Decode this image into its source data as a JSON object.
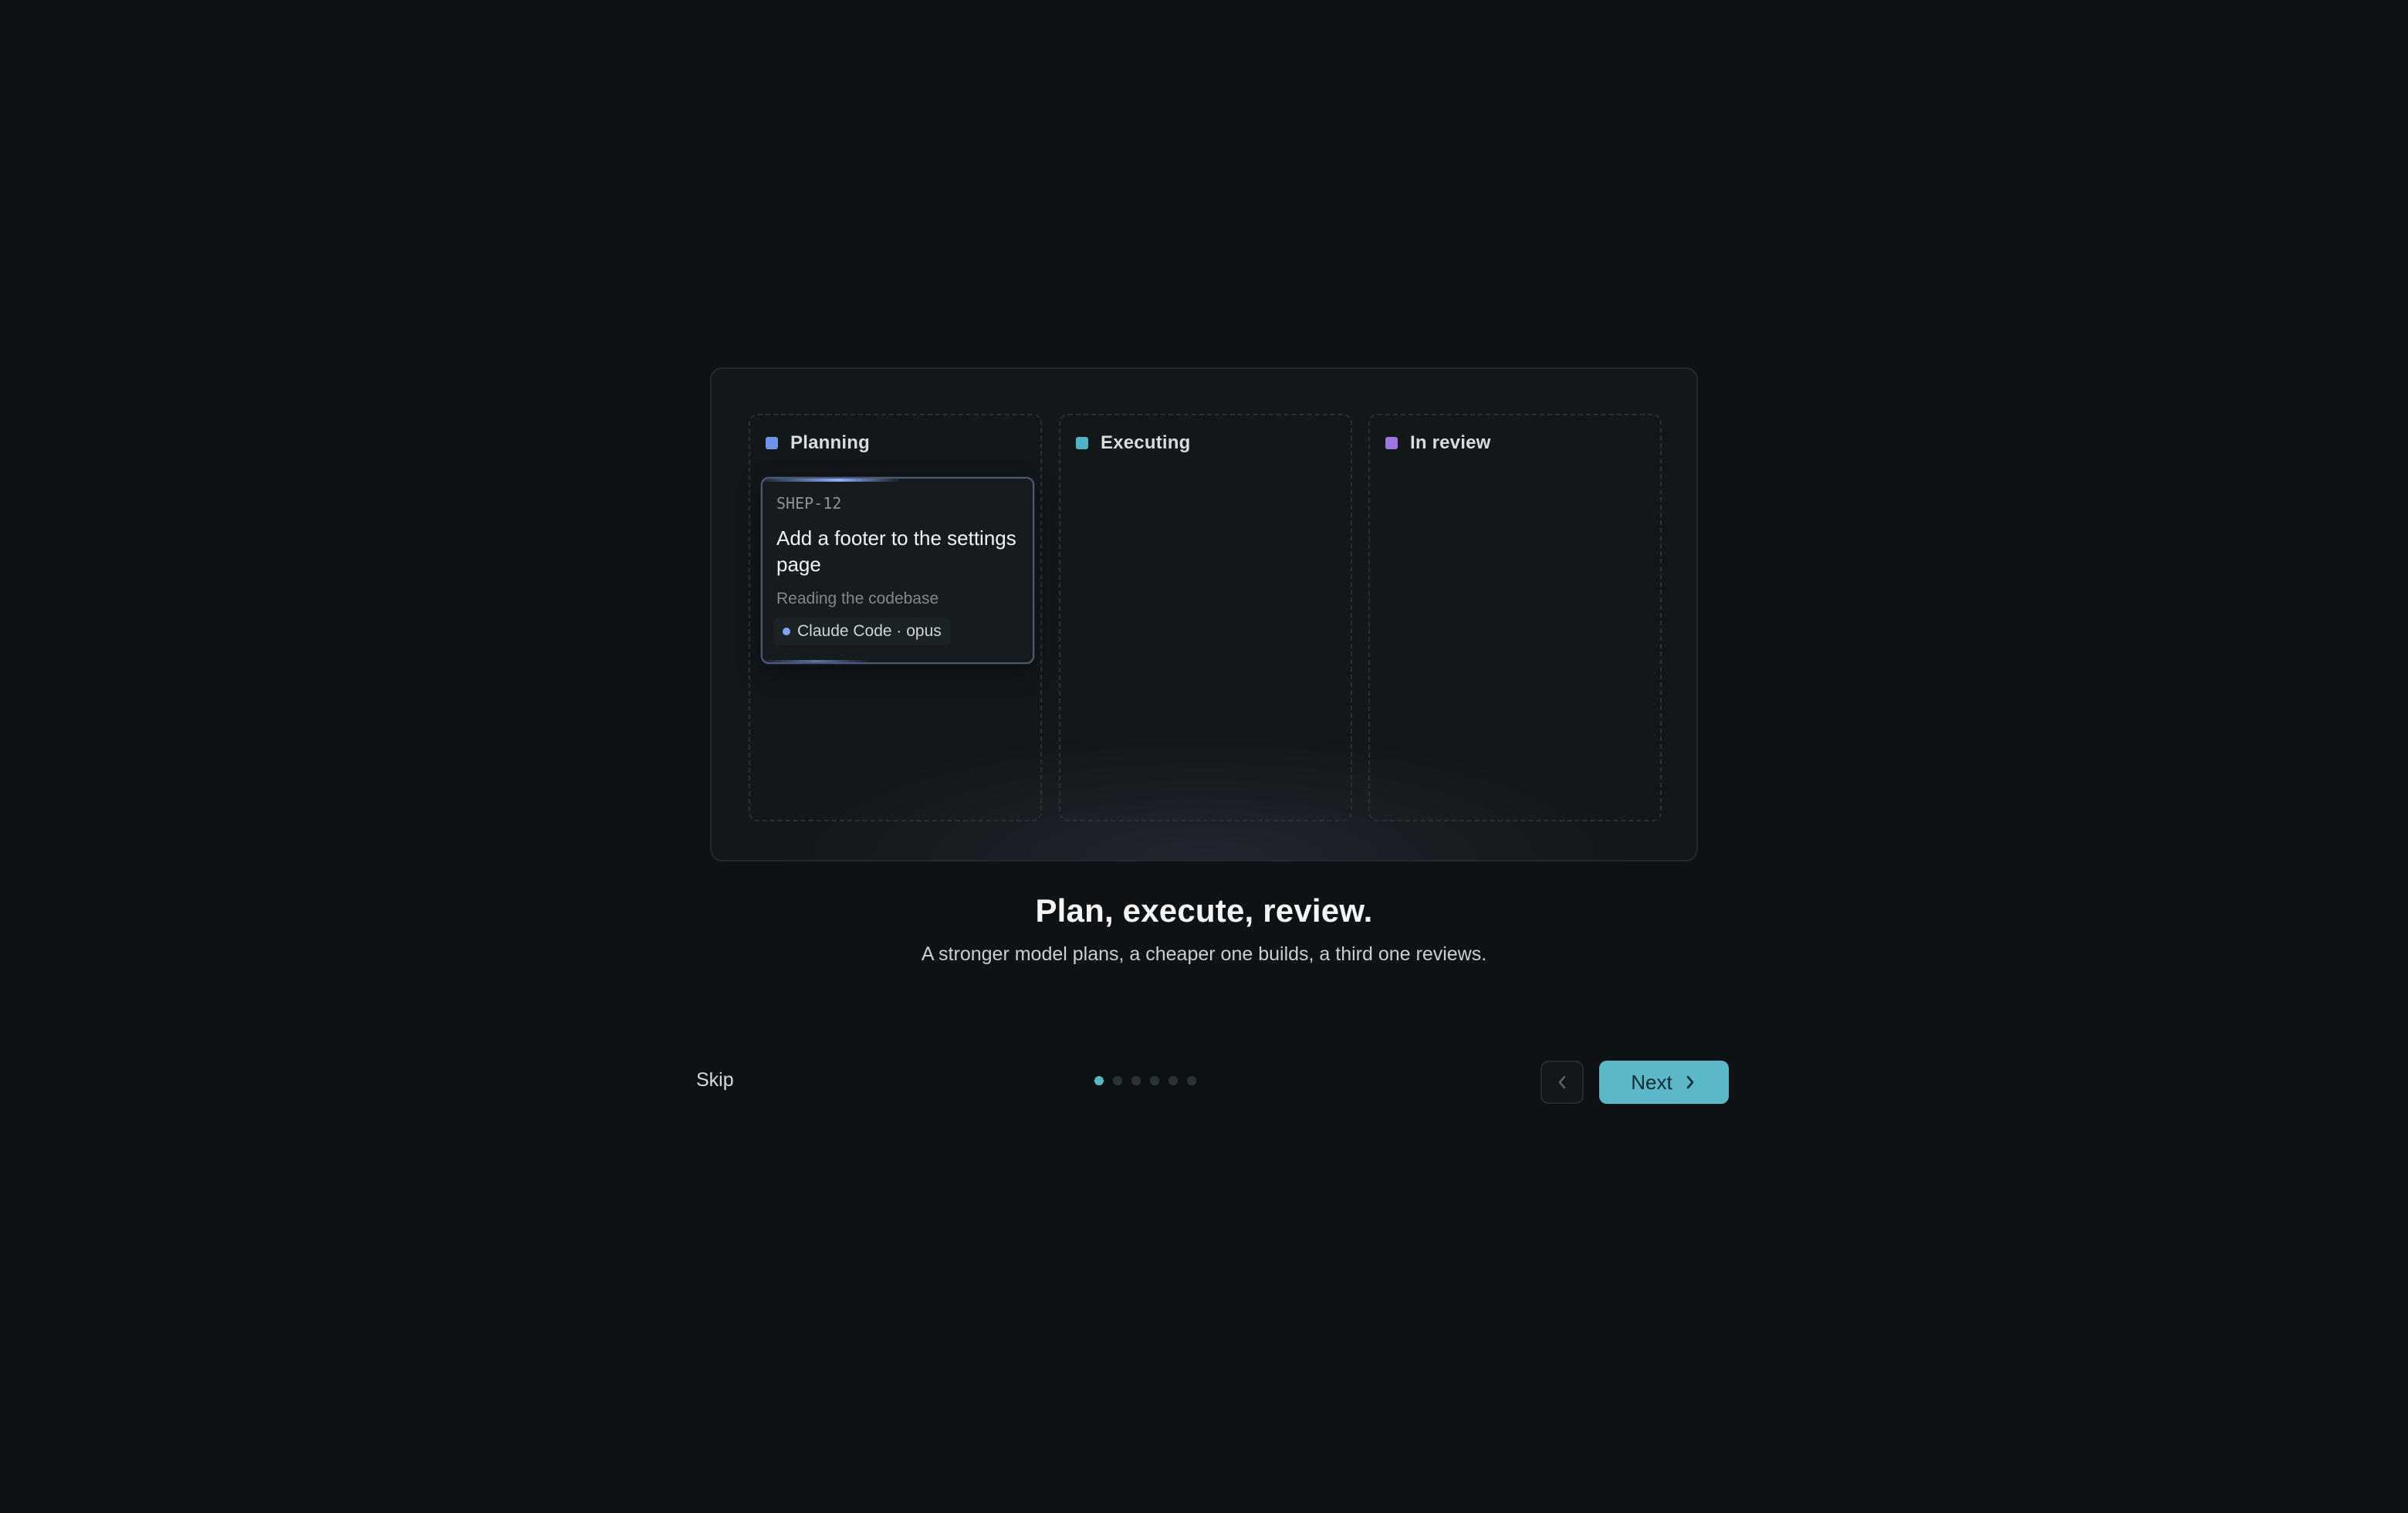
{
  "board": {
    "columns": [
      {
        "title": "Planning",
        "color": "#6f93e8"
      },
      {
        "title": "Executing",
        "color": "#4fb3c4"
      },
      {
        "title": "In review",
        "color": "#a074e0"
      }
    ],
    "card": {
      "id": "SHEP-12",
      "title": "Add a footer to the settings page",
      "status": "Reading the codebase",
      "agent": "Claude Code · opus",
      "agent_dot_color": "#7ea2f0"
    }
  },
  "headline": "Plan, execute, review.",
  "subline": "A stronger model plans, a cheaper one builds, a third one reviews.",
  "nav": {
    "skip_label": "Skip",
    "next_label": "Next",
    "prev_icon": "chevron-left-icon",
    "next_icon": "chevron-right-icon",
    "steps_total": 6,
    "current_step": 1
  },
  "colors": {
    "accent": "#5cb8c9",
    "background": "#0e1214"
  }
}
